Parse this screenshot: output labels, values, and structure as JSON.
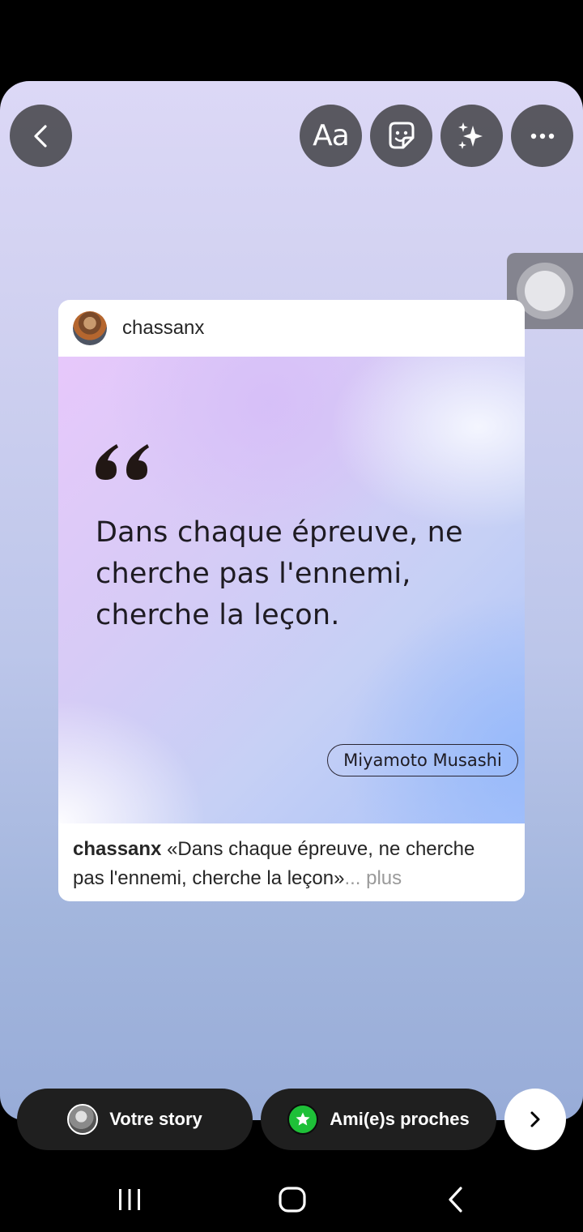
{
  "toolbar": {
    "back_icon": "chevron-left-icon",
    "text_label": "Aa",
    "sticker_icon": "sticker-icon",
    "effects_icon": "sparkles-icon",
    "more_icon": "more-horizontal-icon"
  },
  "floating_button": {
    "icon": "assistive-touch-icon"
  },
  "post": {
    "username": "chassanx",
    "quote_mark": "“",
    "quote_lines": [
      "Dans chaque épreuve, ne",
      "cherche pas l'ennemi,",
      "cherche la leçon."
    ],
    "author": "Miyamoto Musashi",
    "caption_user": "chassanx",
    "caption_line1": " «Dans chaque épreuve, ne cherche",
    "caption_line2": "pas l'ennemi, cherche la leçon»",
    "caption_more": "... plus"
  },
  "share": {
    "your_story_label": "Votre story",
    "close_friends_label": "Ami(e)s proches",
    "close_friends_color": "#1ec038",
    "next_icon": "chevron-right-icon"
  },
  "system_nav": {
    "recents_icon": "recents-icon",
    "home_icon": "home-icon",
    "back_icon": "back-icon"
  }
}
